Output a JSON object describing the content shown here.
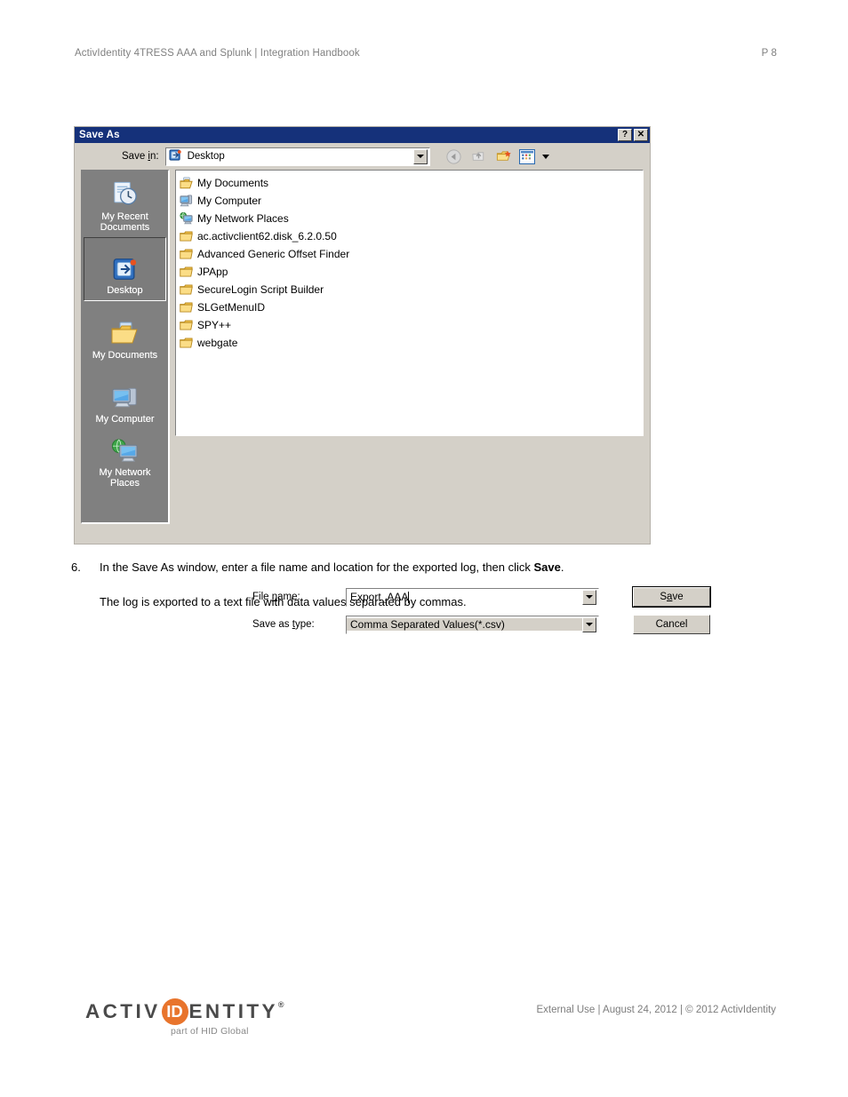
{
  "page": {
    "header_left": "ActivIdentity 4TRESS AAA and Splunk | Integration Handbook",
    "header_right": "P 8"
  },
  "dialog": {
    "title": "Save As",
    "help_button": "?",
    "close_button": "✕",
    "save_in": {
      "label_pre": "Save ",
      "label_accel": "i",
      "label_post": "n:",
      "value": "Desktop",
      "icon": "desktop-icon"
    },
    "toolbar": [
      {
        "name": "back-icon",
        "label": "Back",
        "enabled": false
      },
      {
        "name": "up-one-level-icon",
        "label": "Up One Level",
        "enabled": false
      },
      {
        "name": "new-folder-icon",
        "label": "Create New Folder",
        "enabled": true
      },
      {
        "name": "views-icon",
        "label": "Views",
        "enabled": true
      }
    ],
    "places": [
      {
        "label": "My Recent Documents",
        "icon": "recent-documents-icon",
        "selected": false
      },
      {
        "label": "Desktop",
        "icon": "desktop-icon",
        "selected": true
      },
      {
        "label": "My Documents",
        "icon": "my-documents-icon",
        "selected": false
      },
      {
        "label": "My Computer",
        "icon": "my-computer-icon",
        "selected": false
      },
      {
        "label": "My Network Places",
        "icon": "network-places-icon",
        "selected": false
      }
    ],
    "files": [
      {
        "name": "My Documents",
        "icon": "my-documents-icon"
      },
      {
        "name": "My Computer",
        "icon": "my-computer-icon"
      },
      {
        "name": "My Network Places",
        "icon": "network-places-icon"
      },
      {
        "name": "ac.activclient62.disk_6.2.0.50",
        "icon": "folder-icon"
      },
      {
        "name": "Advanced Generic Offset Finder",
        "icon": "folder-icon"
      },
      {
        "name": "JPApp",
        "icon": "folder-icon"
      },
      {
        "name": "SecureLogin Script Builder",
        "icon": "folder-icon"
      },
      {
        "name": "SLGetMenuID",
        "icon": "folder-icon"
      },
      {
        "name": "SPY++",
        "icon": "folder-icon"
      },
      {
        "name": "webgate",
        "icon": "folder-icon"
      }
    ],
    "file_name": {
      "label_pre": "File ",
      "label_accel": "n",
      "label_post": "ame:",
      "value": "Export_AAA"
    },
    "save_as_type": {
      "label_pre": "Save as ",
      "label_accel": "t",
      "label_post": "ype:",
      "value": "Comma Separated Values(*.csv)"
    },
    "buttons": {
      "save_pre": "S",
      "save_accel": "a",
      "save_post": "ve",
      "cancel": "Cancel"
    }
  },
  "content": {
    "step_number": "6.",
    "step_text_before": "In the Save As window, enter a file name and location for the exported log, then click ",
    "step_text_bold": "Save",
    "step_text_after": ".",
    "paragraph": "The log is exported to a text file with data values separated by commas."
  },
  "footer": {
    "logo_part1": "ACTIV",
    "logo_circle": "ID",
    "logo_part2": "ENTITY",
    "logo_reg": "®",
    "logo_tagline": "part of HID Global",
    "right_text": "External Use | August 24, 2012 | © 2012 ActivIdentity",
    "accent_color": "#e8742c"
  }
}
